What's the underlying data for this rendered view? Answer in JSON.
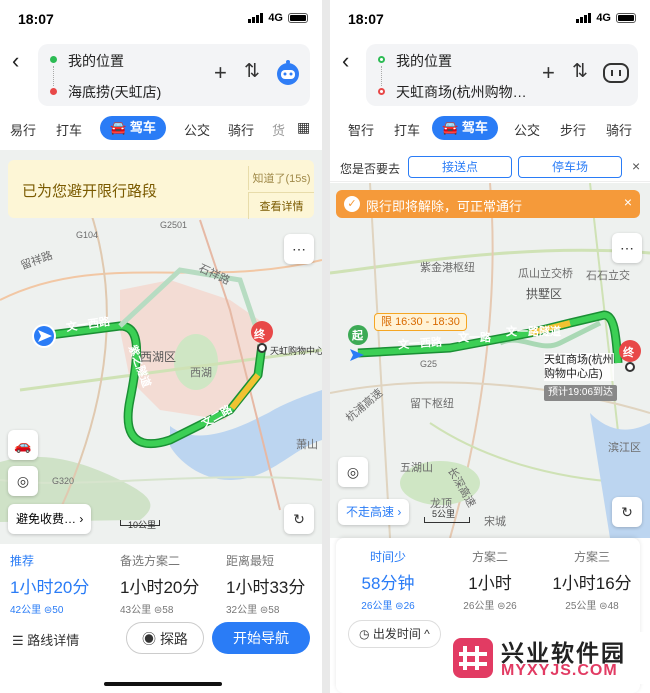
{
  "left": {
    "status": {
      "time": "18:07",
      "network": "4G"
    },
    "route": {
      "from": "我的位置",
      "to": "海底捞(天虹店)"
    },
    "modes": [
      "易行",
      "打车",
      "驾车",
      "公交",
      "骑行",
      "货"
    ],
    "notice": {
      "title": "已为您避开限行路段",
      "dismiss": "知道了(15s)",
      "details": "查看详情"
    },
    "map_labels": {
      "road_wenyi": "文一西路",
      "road_ziyou": "紫之隧道",
      "road_tianmu": "留祥路",
      "road_shixiang": "石祥路",
      "road_wener": "文二路",
      "district": "西湖区",
      "xihu": "西湖",
      "end_name": "天虹购物中心",
      "end_marker": "终",
      "shangshan": "萧山",
      "scale": "10公里",
      "g104": "G104",
      "g320": "G320",
      "g2501": "G2501"
    },
    "avoid_toll": "避免收费…",
    "options": [
      {
        "tag": "推荐",
        "duration": "1小时20分",
        "distance": "42公里",
        "lights": "50"
      },
      {
        "tag": "备选方案二",
        "duration": "1小时20分",
        "distance": "43公里",
        "lights": "58"
      },
      {
        "tag": "距离最短",
        "duration": "1小时33分",
        "distance": "32公里",
        "lights": "58"
      }
    ],
    "route_details": "路线详情",
    "explore": "探路",
    "start_nav": "开始导航"
  },
  "right": {
    "status": {
      "time": "18:07",
      "network": "4G"
    },
    "route": {
      "from": "我的位置",
      "to": "天虹商场(杭州购物…"
    },
    "modes": [
      "智行",
      "打车",
      "驾车",
      "公交",
      "步行",
      "骑行"
    ],
    "prompt": {
      "question": "您是否要去",
      "option1": "接送点",
      "option2": "停车场"
    },
    "notice": {
      "title": "限行即将解除，可正常通行"
    },
    "time_window": "16:30 - 18:30",
    "map_labels": {
      "zijingang": "紫金港枢纽",
      "guashan": "瓜山立交桥",
      "shijiao": "石石立交",
      "gongshu": "拱墅区",
      "road_wenyi": "文一西路",
      "road_wenyi2": "文一路",
      "road_tunnel": "文一路隧道",
      "start_marker": "起",
      "end_marker": "终",
      "end_name": "天虹商场(杭州",
      "end_name2": "购物中心店)",
      "eta": "预计19:06到达",
      "liutong": "留下枢纽",
      "wuyun": "五湖山",
      "jiangbin": "滨江区",
      "hangqian": "杭浦高速",
      "songcheng": "宋城",
      "longding": "龙顶",
      "changshen": "长深高速",
      "scale": "5公里",
      "g25": "G25"
    },
    "no_highway": "不走高速",
    "options": [
      {
        "tag": "时间少",
        "duration": "58分钟",
        "distance": "26公里",
        "lights": "26"
      },
      {
        "tag": "方案二",
        "duration": "1小时",
        "distance": "26公里",
        "lights": "26"
      },
      {
        "tag": "方案三",
        "duration": "1小时16分",
        "distance": "25公里",
        "lights": "48"
      }
    ],
    "depart_time": "出发时间"
  },
  "watermark": {
    "title": "兴业软件园",
    "url": "MYXYJS.COM"
  }
}
